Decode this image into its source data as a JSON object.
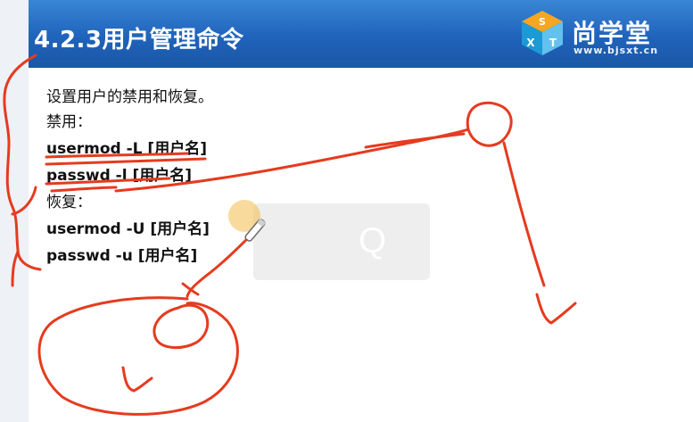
{
  "slide": {
    "title": "4.2.3用户管理命令",
    "logo_text": "尚学堂",
    "logo_url": "www.bjsxt.cn",
    "logo_cube_letters": [
      "S",
      "X",
      "T"
    ],
    "lines": [
      "设置用户的禁用和恢复。",
      "禁用：",
      "usermod -L [用户名]",
      "passwd -l [用户名]",
      "恢复：",
      "usermod -U [用户名]",
      "passwd -u [用户名]"
    ],
    "overlay_letter": "Q"
  },
  "colors": {
    "header_blue": "#1f63bb",
    "pen_red": "#e53b1f",
    "cursor_highlight": "#f3c35a"
  },
  "icons": {
    "cursor": "pen-cursor-icon"
  }
}
